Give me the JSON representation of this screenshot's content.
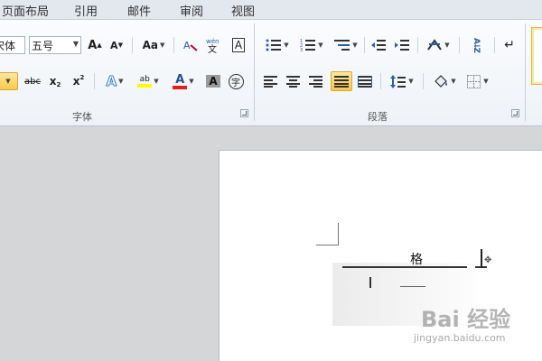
{
  "menu_tabs": [
    "页面布局",
    "引用",
    "邮件",
    "审阅",
    "视图"
  ],
  "font_group": {
    "label": "字体",
    "font_name_value": "宋体",
    "font_size_value": "五号",
    "grow_font": "A",
    "shrink_font": "A",
    "change_case": "Aa",
    "clear_formatting": "A",
    "phonetic": "wén",
    "char_border": "A",
    "strikethrough": "abc",
    "subscript": "x",
    "superscript": "x",
    "text_effect": "A",
    "highlight": "ab",
    "font_color": "A",
    "char_shading": "A",
    "enclose": "字"
  },
  "paragraph_group": {
    "label": "段落",
    "sort": "A↓Z"
  },
  "document": {
    "visible_char": "格"
  },
  "watermark": {
    "brand": "Bai 经验",
    "url": "jingyan.baidu.com"
  },
  "colors": {
    "highlight": "#ffff00",
    "font_color": "#e02020",
    "active": "#f8c94a"
  }
}
